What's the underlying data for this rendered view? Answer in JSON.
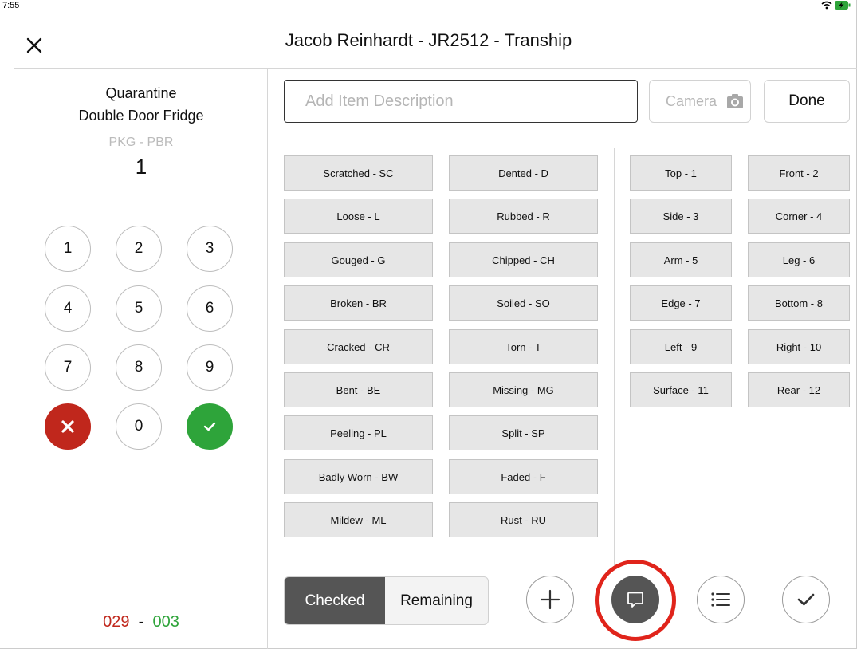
{
  "status": {
    "time": "7:55",
    "icons": "wifi-icon battery-charging-icon"
  },
  "header": {
    "title": "Jacob Reinhardt - JR2512 - Tranship",
    "close_icon": "close-icon"
  },
  "item": {
    "line1": "Quarantine",
    "line2": "Double Door Fridge",
    "pkg": "PKG - PBR",
    "qty": "1"
  },
  "keypad": {
    "keys": [
      "1",
      "2",
      "3",
      "4",
      "5",
      "6",
      "7",
      "8",
      "9",
      "0"
    ],
    "cancel_icon": "cancel-icon",
    "confirm_icon": "confirm-icon"
  },
  "counts": {
    "checked": "029",
    "sep": "-",
    "remaining": "003"
  },
  "toolbar": {
    "description_placeholder": "Add Item Description",
    "camera_label": "Camera",
    "done_label": "Done"
  },
  "conditions": [
    "Scratched - SC",
    "Dented - D",
    "Loose - L",
    "Rubbed - R",
    "Gouged - G",
    "Chipped - CH",
    "Broken - BR",
    "Soiled - SO",
    "Cracked - CR",
    "Torn - T",
    "Bent - BE",
    "Missing - MG",
    "Peeling - PL",
    "Split - SP",
    "Badly Worn - BW",
    "Faded - F",
    "Mildew - ML",
    "Rust - RU"
  ],
  "locations": [
    "Top - 1",
    "Front - 2",
    "Side - 3",
    "Corner - 4",
    "Arm - 5",
    "Leg - 6",
    "Edge - 7",
    "Bottom - 8",
    "Left - 9",
    "Right - 10",
    "Surface - 11",
    "Rear - 12"
  ],
  "bottom": {
    "checked_label": "Checked",
    "remaining_label": "Remaining",
    "actions": [
      "add-icon",
      "comment-icon",
      "list-icon",
      "check-icon"
    ],
    "highlight_color": "#e0241b"
  },
  "colors": {
    "red": "#c0271c",
    "green": "#2ea43a",
    "dark": "#555555",
    "tag_bg": "#e6e6e6"
  }
}
